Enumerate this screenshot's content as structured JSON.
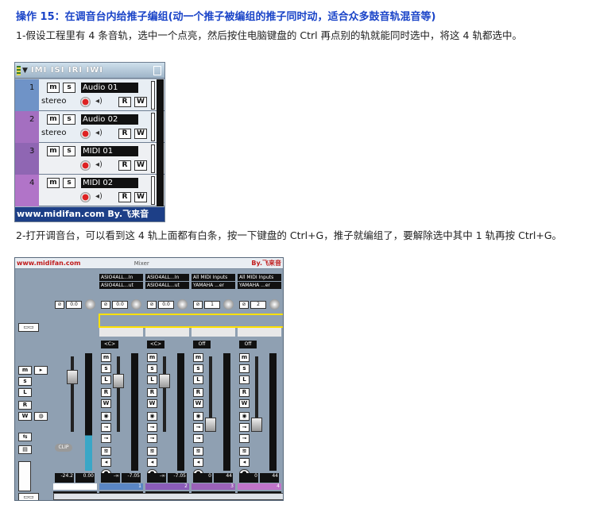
{
  "heading": "操作 15：在调音台内给推子编组(动一个推子被编组的推子同时动，适合众多鼓音轨混音等)",
  "para1": "1-假设工程里有 4 条音轨，选中一个点亮，然后按住电脑键盘的 Ctrl 再点别的轨就能同时选中，将这 4 轨都选中。",
  "para2": "2-打开调音台，可以看到这 4 轨上面都有白条，按一下键盘的 Ctrl+G，推子就编组了，要解除选中其中 1 轨再按 Ctrl+G。",
  "tracklist": {
    "header": "IMI ISI IRI IWI",
    "mute": "m",
    "solo": "s",
    "rec_btn": "R",
    "write_btn": "W",
    "stereo": "stereo",
    "watermark": "www.midifan.com By.飞来音",
    "tracks": [
      {
        "num": "1",
        "name": "Audio 01",
        "color": "#6f93c7",
        "row2": "stereo"
      },
      {
        "num": "2",
        "name": "Audio 02",
        "color": "#a46fc0",
        "row2": "stereo"
      },
      {
        "num": "3",
        "name": "MIDI 01",
        "color": "#8f66b3",
        "row2": ""
      },
      {
        "num": "4",
        "name": "MIDI 02",
        "color": "#b174c8",
        "row2": ""
      }
    ]
  },
  "mixer": {
    "title_left": "www.midifan.com",
    "title_mid": "Mixer",
    "title_right": "By.飞来音",
    "strips": [
      {
        "in1": "ASIO4ALL...In",
        "in2": "ASIO4ALL...ut",
        "gain": "0.0",
        "pan": "<C>",
        "readL": "-∞",
        "readR": "-7.05",
        "num": "1",
        "name": "Audio 01",
        "color": "#5a86c4"
      },
      {
        "in1": "ASIO4ALL...In",
        "in2": "ASIO4ALL...ut",
        "gain": "0.0",
        "pan": "<C>",
        "readL": "-∞",
        "readR": "-7.05",
        "num": "2",
        "name": "Audio 02",
        "color": "#8a5cb8"
      },
      {
        "in1": "All MIDI Inputs",
        "in2": "YAMAHA ...er",
        "gain": "1",
        "pan": "Off",
        "readL": "0",
        "readR": "44",
        "num": "3",
        "name": "MIDI 01",
        "color": "#9b62b8"
      },
      {
        "in1": "All MIDI Inputs",
        "in2": "YAMAHA ...er",
        "gain": "2",
        "pan": "Off",
        "readL": "0",
        "readR": "44",
        "num": "4",
        "name": "MIDI 02",
        "color": "#c074c9"
      }
    ],
    "master": {
      "gain": "0.0",
      "readL": "-24.2",
      "readR": "0.00",
      "name": "ASIO4ALL v2",
      "clip": "CLIP"
    },
    "btn_m": "m",
    "btn_s": "s",
    "btn_l": "L",
    "btn_r": "R",
    "btn_w": "W"
  }
}
